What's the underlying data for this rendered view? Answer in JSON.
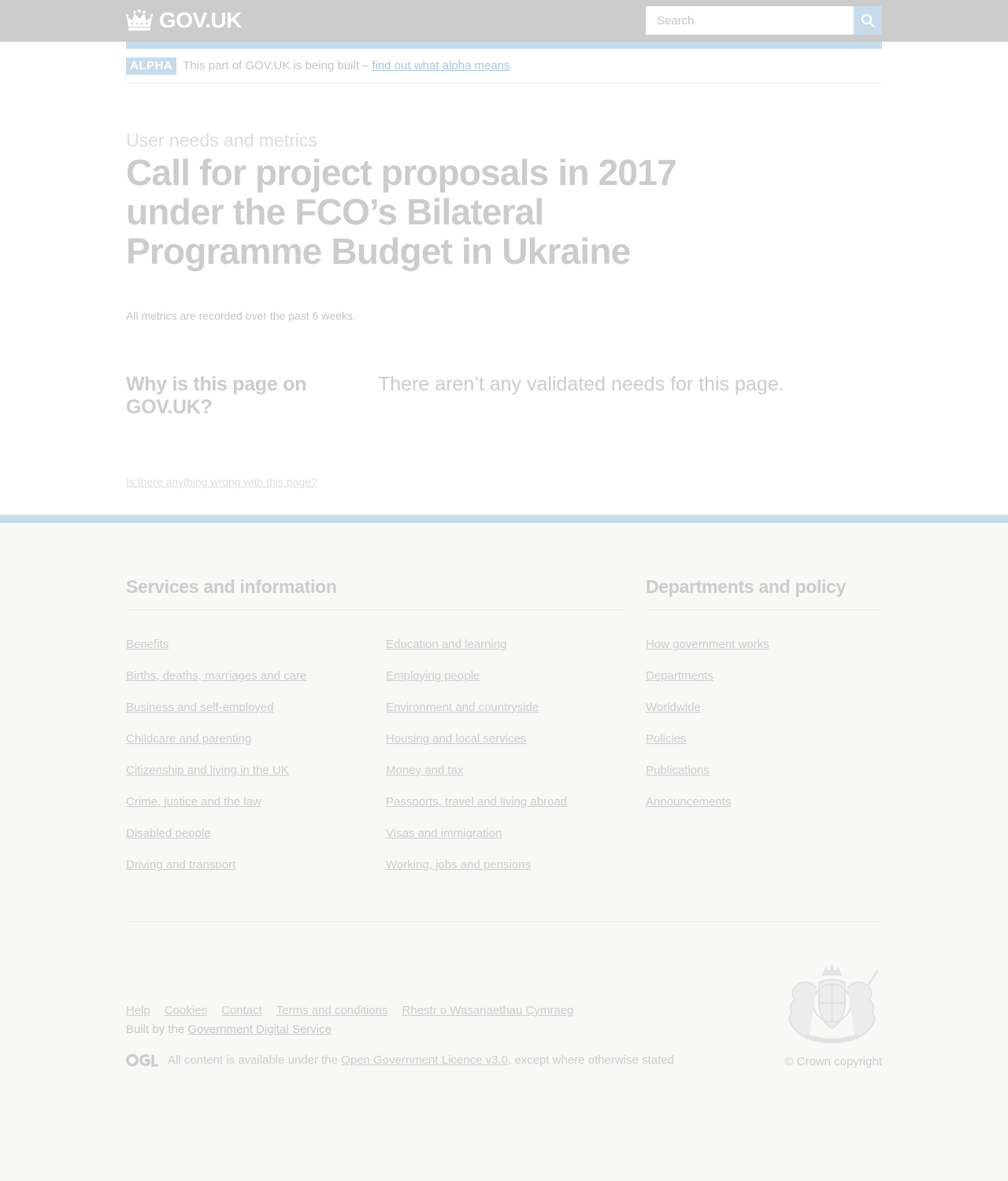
{
  "header": {
    "logo_text": "GOV.UK",
    "search_placeholder": "Search",
    "colors": {
      "bar": "#cccccc",
      "accent": "#c6dcec"
    }
  },
  "phase_banner": {
    "tag": "ALPHA",
    "text": "This part of GOV.UK is being built –",
    "link": "find out what alpha means"
  },
  "main": {
    "caption": "User needs and metrics",
    "title": "Call for project proposals in 2017 under the FCO’s Bilateral Programme Budget in Ukraine",
    "metrics_note": "All metrics are recorded over the past 6 weeks.",
    "why_heading": "Why is this page on GOV.UK?",
    "no_needs": "There aren’t any validated needs for this page.",
    "report_link": "Is there anything wrong with this page?"
  },
  "footer": {
    "services_heading": "Services and information",
    "departments_heading": "Departments and policy",
    "services_col1": [
      "Benefits",
      "Births, deaths, marriages and care",
      "Business and self-employed",
      "Childcare and parenting",
      "Citizenship and living in the UK",
      "Crime, justice and the law",
      "Disabled people",
      "Driving and transport"
    ],
    "services_col2": [
      "Education and learning",
      "Employing people",
      "Environment and countryside",
      "Housing and local services",
      "Money and tax",
      "Passports, travel and living abroad",
      "Visas and immigration",
      "Working, jobs and pensions"
    ],
    "departments": [
      "How government works",
      "Departments",
      "Worldwide",
      "Policies",
      "Publications",
      "Announcements"
    ],
    "meta_links": [
      "Help",
      "Cookies",
      "Contact",
      "Terms and conditions",
      "Rhestr o Wasanaethau Cymraeg"
    ],
    "built_by_prefix": "Built by the",
    "built_by_link": "Government Digital Service",
    "licence_prefix": "All content is available under the",
    "licence_link": "Open Government Licence v3.0",
    "licence_suffix": ", except where otherwise stated",
    "copyright": "© Crown copyright"
  }
}
